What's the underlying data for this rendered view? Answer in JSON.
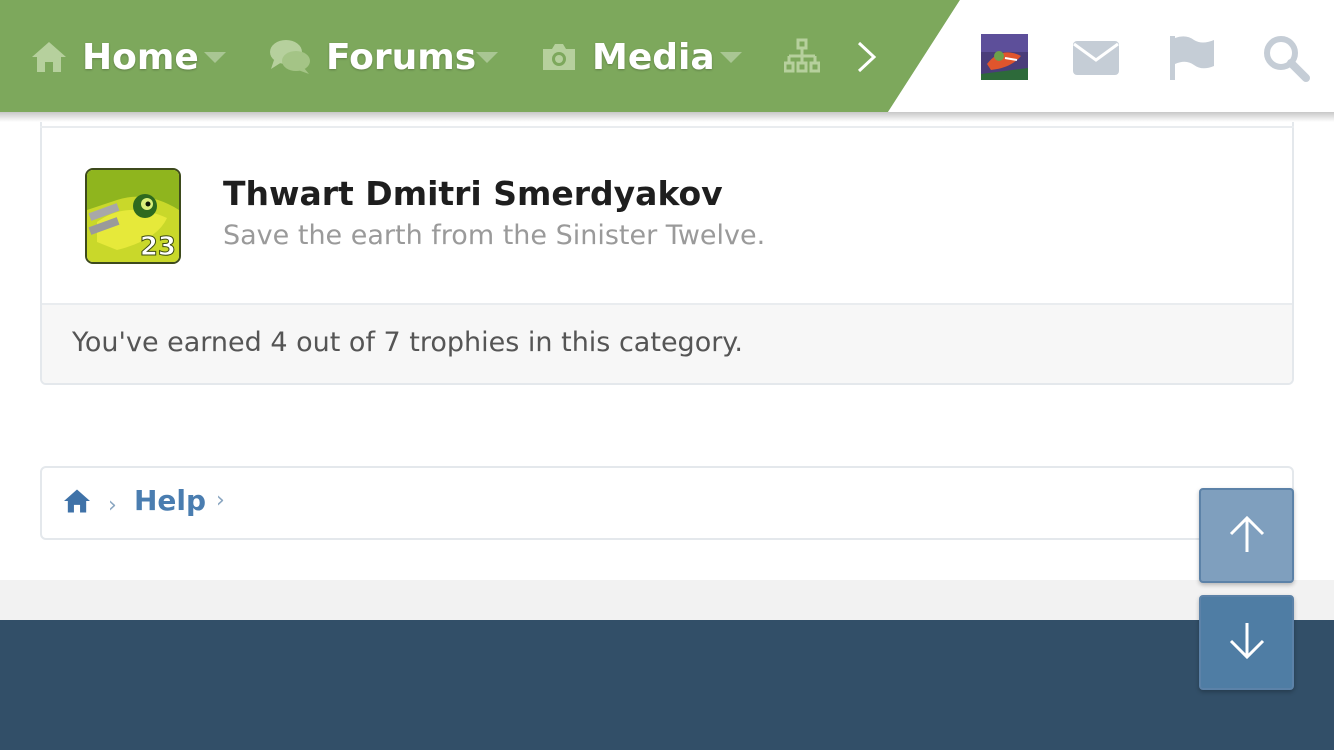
{
  "nav": {
    "tabs": [
      {
        "label": "Home",
        "icon": "home-icon"
      },
      {
        "label": "Forums",
        "icon": "comments-icon"
      },
      {
        "label": "Media",
        "icon": "camera-icon"
      }
    ],
    "more_icon": "sitemap-icon",
    "scroll_icon": "chevron-right-icon",
    "right_icons": [
      "avatar",
      "envelope-icon",
      "flag-icon",
      "search-icon"
    ],
    "colors": {
      "bar": "#7da85c",
      "icon_muted": "#c5cdd6"
    }
  },
  "trophy": {
    "badge_number": "23",
    "title": "Thwart Dmitri Smerdyakov",
    "description": "Save the earth from the Sinister Twelve."
  },
  "summary": "You've earned 4 out of 7 trophies in this category.",
  "breadcrumb": {
    "home_icon": "home-icon",
    "items": [
      "Help"
    ]
  },
  "scroll": {
    "up_icon": "arrow-up-icon",
    "down_icon": "arrow-down-icon"
  },
  "footer": {
    "color": "#324f68"
  }
}
